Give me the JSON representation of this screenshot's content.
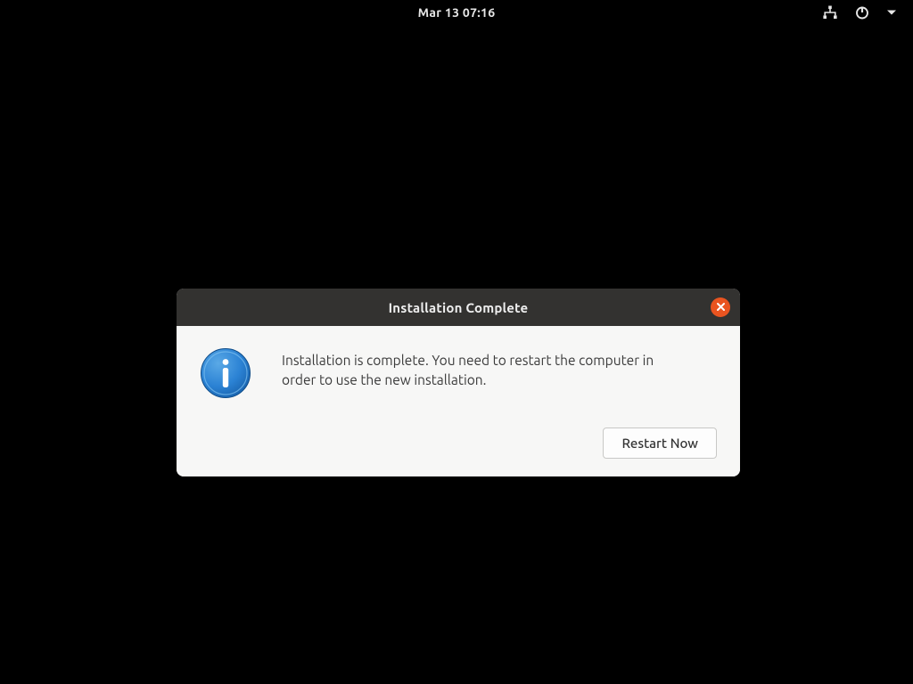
{
  "topbar": {
    "datetime": "Mar 13  07:16"
  },
  "dialog": {
    "title": "Installation Complete",
    "message": "Installation is complete. You need to restart the computer in order to use the new installation.",
    "restart_label": "Restart Now"
  }
}
